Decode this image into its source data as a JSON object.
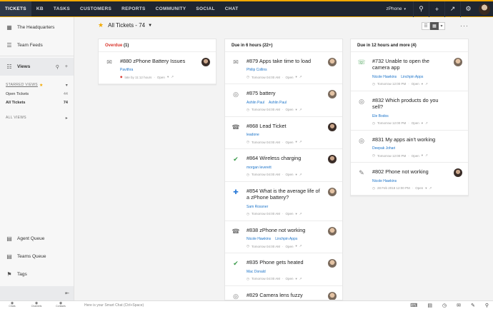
{
  "topbar": {
    "nav": [
      "TICKETS",
      "KB",
      "TASKS",
      "CUSTOMERS",
      "REPORTS",
      "COMMUNITY",
      "SOCIAL",
      "CHAT"
    ],
    "active": "TICKETS",
    "brand": "zPhone",
    "accent": "#f2a900",
    "icons": [
      "search-icon",
      "plus-icon",
      "external-icon",
      "gear-icon"
    ]
  },
  "sidebar": {
    "headquarters": "The Headquarters",
    "team_feeds": "Team Feeds",
    "views": "Views",
    "starred_views": "STARRED VIEWS",
    "starred": [
      {
        "label": "Open Tickets",
        "count": "44"
      },
      {
        "label": "All Tickets",
        "count": "74"
      }
    ],
    "all_views": "ALL VIEWS",
    "agent_queue": "Agent Queue",
    "teams_queue": "Teams Queue",
    "tags": "Tags"
  },
  "bottombar": {
    "tabs": [
      "Chats",
      "Channels",
      "Contacts"
    ],
    "chat_placeholder": "Here is your Smart Chat (Ctrl+Space)"
  },
  "main": {
    "title": "All Tickets - 74",
    "columns": [
      {
        "title": "Overdue",
        "count": "(1)",
        "cards": [
          {
            "icon": "mail-icon",
            "title": "#880 zPhone Battery Issues",
            "contacts": [
              "Pavithra"
            ],
            "time": "late by 11:12 hours",
            "status": "Open",
            "late": true,
            "avatar": "a1"
          }
        ]
      },
      {
        "title": "Due in 6 hours",
        "count": "(22+)",
        "cards": [
          {
            "icon": "mail-icon",
            "title": "#879 Apps take time to load",
            "contacts": [
              "Philip Collins"
            ],
            "time": "Tomorrow 04:00 AM",
            "status": "Open",
            "avatar": "a2"
          },
          {
            "icon": "globe-icon",
            "title": "#875 battery",
            "contacts": [
              "Ashlin Paul",
              "Ashlin Paul"
            ],
            "time": "Tomorrow 04:00 AM",
            "status": "Open",
            "avatar": "a2"
          },
          {
            "icon": "phone-icon",
            "title": "#868 Lead Ticket",
            "contacts": [
              "leadone"
            ],
            "time": "Tomorrow 04:00 AM",
            "status": "Open",
            "avatar": "a1"
          },
          {
            "icon": "chat-icon",
            "title": "#864 Wireless charging",
            "contacts": [
              "morgan leverett"
            ],
            "time": "Tomorrow 04:00 AM",
            "status": "Open",
            "avatar": "a1"
          },
          {
            "icon": "feedback-icon",
            "title": "#854 What is the average life of a zPhone battery?",
            "contacts": [
              "Sam Rossner"
            ],
            "time": "Tomorrow 04:00 AM",
            "status": "Open",
            "avatar": "a2"
          },
          {
            "icon": "phone-icon",
            "title": "#838 zPhone not working",
            "contacts": [
              "Nicole Hawkins",
              "Linchpin Apps"
            ],
            "time": "Tomorrow 04:00 AM",
            "status": "Open",
            "avatar": "a2"
          },
          {
            "icon": "chat-icon",
            "title": "#835 Phone gets heated",
            "contacts": [
              "Mac Donald"
            ],
            "time": "Tomorrow 04:00 AM",
            "status": "Open",
            "avatar": "a2"
          },
          {
            "icon": "globe-icon",
            "title": "#829 Camera lens fuzzy",
            "contacts": [],
            "time": "",
            "status": "",
            "avatar": "a2"
          }
        ]
      },
      {
        "title": "Due in 12 hours and more",
        "count": "(4)",
        "cards": [
          {
            "icon": "phone-incoming-icon",
            "title": "#732 Unable to open the camera app",
            "contacts": [
              "Nicole Hawkins",
              "Linchpin Apps"
            ],
            "time": "Tomorrow 12:00 PM",
            "status": "Open",
            "avatar": "a2"
          },
          {
            "icon": "globe-icon",
            "title": "#832 Which products do you sell?",
            "contacts": [
              "Ele Bodos"
            ],
            "time": "Tomorrow 12:00 PM",
            "status": "Open",
            "avatar": ""
          },
          {
            "icon": "globe-icon",
            "title": "#831 My apps ain't working",
            "contacts": [
              "Deepak Johari"
            ],
            "time": "Tomorrow 12:00 PM",
            "status": "Open",
            "avatar": ""
          },
          {
            "icon": "edit-icon",
            "title": "#802 Phone not working",
            "contacts": [
              "Nicole Hawkins"
            ],
            "time": "28 Feb 2018 12:00 PM",
            "status": "Open",
            "avatar": "a1"
          }
        ]
      }
    ]
  }
}
